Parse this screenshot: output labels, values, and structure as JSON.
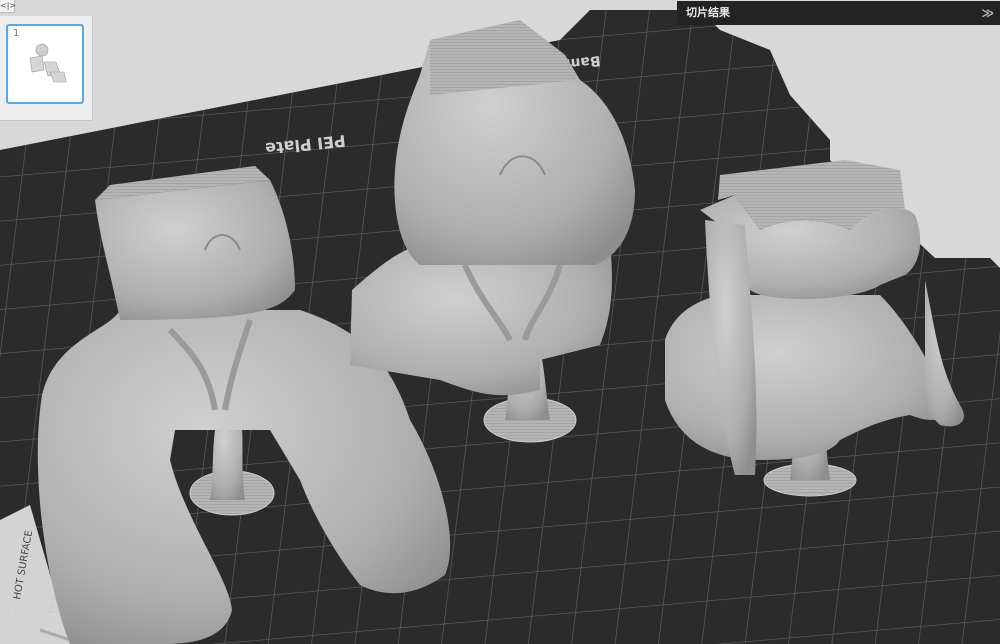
{
  "header": {
    "collapse_toggle_glyph": "<|>"
  },
  "plate_list": {
    "items": [
      {
        "number": "1"
      }
    ]
  },
  "slice_results": {
    "title": "切片结果",
    "expand_glyph": "≫"
  },
  "build_plate": {
    "top_logo_text": "Bambu",
    "plate_label": "PEI Plate",
    "side_warning_text": "HOT SURFACE"
  },
  "colors": {
    "plate": "#2b2b2b",
    "plate_grid": "#676767",
    "model": "#b2b2b2",
    "panel_bg": "#232323",
    "accent": "#5aa6ea"
  },
  "icons": [
    "collapse-toggle-icon",
    "chevron-double-down-icon",
    "plate-thumbnail-models-icon",
    "hot-surface-warning-icon"
  ]
}
